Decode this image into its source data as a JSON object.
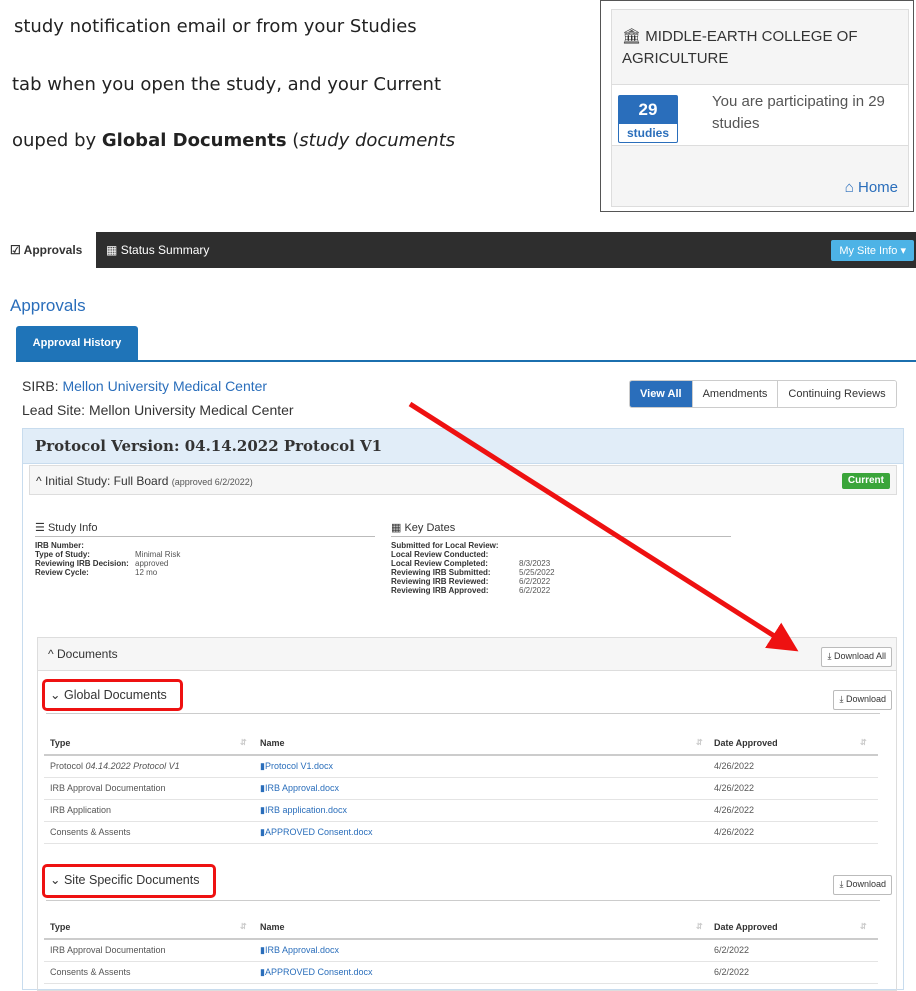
{
  "doc_lines": {
    "line1": "study notification email or from your Studies",
    "line2": "tab when you open the study, and your Current",
    "line3_pre": "ouped by ",
    "line3_bold": "Global Documents",
    "line3_mid": " (",
    "line3_ital": "study documents"
  },
  "institution": {
    "name": "MIDDLE-EARTH COLLEGE OF AGRICULTURE",
    "count": "29",
    "count_label": "studies",
    "participating_text": "You are participating in 29 studies",
    "home_label": "Home"
  },
  "nav": {
    "tabs": [
      "Approvals",
      "Status Summary"
    ],
    "site_info": "My Site Info"
  },
  "page": {
    "title": "Approvals",
    "tab": "Approval History",
    "sirb_label": "SIRB: ",
    "sirb_value": "Mellon University Medical Center",
    "lead_site": "Lead Site: Mellon University Medical Center",
    "filters": [
      "View All",
      "Amendments",
      "Continuing Reviews"
    ]
  },
  "protocol": {
    "header": "Protocol Version: 04.14.2022 Protocol V1",
    "initial_study": "Initial Study: Full Board",
    "initial_note": "(approved 6/2/2022)",
    "status": "Current"
  },
  "study_info": {
    "title": "Study Info",
    "fields": [
      {
        "k": "IRB Number:",
        "v": ""
      },
      {
        "k": "Type of Study:",
        "v": "Minimal Risk"
      },
      {
        "k": "Reviewing IRB Decision:",
        "v": "approved"
      },
      {
        "k": "Review Cycle:",
        "v": "12 mo"
      }
    ]
  },
  "key_dates": {
    "title": "Key Dates",
    "fields": [
      {
        "k": "Submitted for Local Review:",
        "v": ""
      },
      {
        "k": "Local Review Conducted:",
        "v": ""
      },
      {
        "k": "Local Review Completed:",
        "v": "8/3/2023"
      },
      {
        "k": "Reviewing IRB Submitted:",
        "v": "5/25/2022"
      },
      {
        "k": "Reviewing IRB Reviewed:",
        "v": "6/2/2022"
      },
      {
        "k": "Reviewing IRB Approved:",
        "v": "6/2/2022"
      }
    ]
  },
  "documents": {
    "title": "Documents",
    "download_all": "Download All",
    "download": "Download",
    "columns": [
      "Type",
      "Name",
      "Date Approved"
    ],
    "global": {
      "title": "Global Documents",
      "rows": [
        {
          "type": "Protocol",
          "type_italic": "04.14.2022 Protocol V1",
          "name": "Protocol V1.docx",
          "date": "4/26/2022"
        },
        {
          "type": "IRB Approval Documentation",
          "type_italic": "",
          "name": "IRB Approval.docx",
          "date": "4/26/2022"
        },
        {
          "type": "IRB Application",
          "type_italic": "",
          "name": "IRB application.docx",
          "date": "4/26/2022"
        },
        {
          "type": "Consents & Assents",
          "type_italic": "",
          "name": "APPROVED Consent.docx",
          "date": "4/26/2022"
        }
      ]
    },
    "site": {
      "title": "Site Specific Documents",
      "rows": [
        {
          "type": "IRB Approval Documentation",
          "type_italic": "",
          "name": "IRB Approval.docx",
          "date": "6/2/2022"
        },
        {
          "type": "Consents & Assents",
          "type_italic": "",
          "name": "APPROVED Consent.docx",
          "date": "6/2/2022"
        }
      ]
    }
  },
  "colors": {
    "accent": "#2a6ebb",
    "nav_bg": "#2e2e2e",
    "current": "#3aa53a",
    "highlight": "#ee1111"
  }
}
